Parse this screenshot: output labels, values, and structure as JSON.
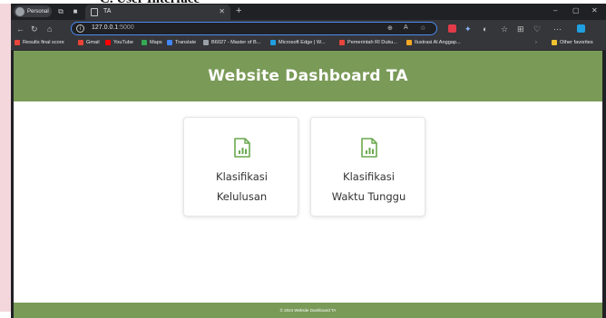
{
  "document": {
    "cropped_heading": "C.   User Interface"
  },
  "browser": {
    "profile_label": "Personal",
    "tab": {
      "title": "TA"
    },
    "new_tab_symbol": "+",
    "window_controls": {
      "minimize": "–",
      "maximize": "▢",
      "close": "✕"
    },
    "address": {
      "host": "127.0.0.1",
      "port": ":5000"
    },
    "bookmarks": [
      {
        "label": "Results final score",
        "color": "#e8453c"
      },
      {
        "label": "Gmail",
        "color": "#ea4335"
      },
      {
        "label": "YouTube",
        "color": "#ff0000"
      },
      {
        "label": "Maps",
        "color": "#34a853"
      },
      {
        "label": "Translate",
        "color": "#4285f4"
      },
      {
        "label": "B6027 - Master of B...",
        "color": "#9aa0a6"
      },
      {
        "label": "Microsoft Edge | W...",
        "color": "#1fa0e0"
      },
      {
        "label": "Pemerintah RI Duku...",
        "color": "#e8453c"
      },
      {
        "label": "Ilustrasi Al Anggap...",
        "color": "#f5a623"
      }
    ],
    "other_favorites": "Other favorites"
  },
  "page": {
    "header_title": "Website Dashboard TA",
    "cards": [
      {
        "line1": "Klasifikasi",
        "line2": "Kelulusan"
      },
      {
        "line1": "Klasifikasi",
        "line2": "Waktu Tunggu"
      }
    ],
    "footer_text": "© 2024 Website Dashboard TA"
  },
  "colors": {
    "header_green": "#7a9a58",
    "icon_green": "#6aa84f",
    "browser_dark": "#202124",
    "toolbar": "#35363a",
    "omnibox_border": "#4c8bf5"
  }
}
